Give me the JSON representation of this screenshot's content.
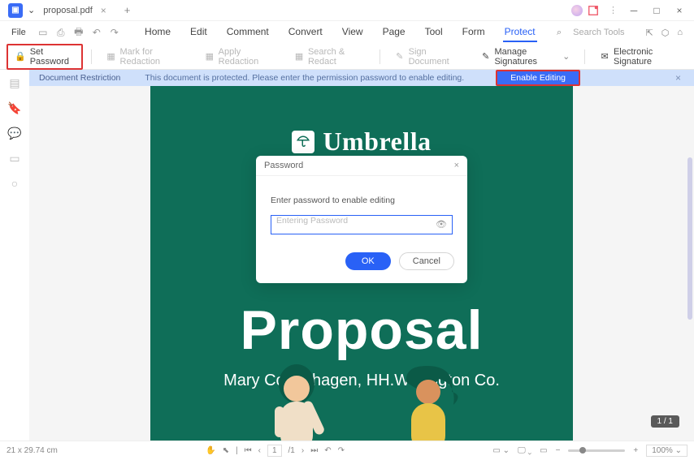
{
  "titlebar": {
    "filename": "proposal.pdf"
  },
  "file_menu": {
    "label": "File"
  },
  "menu_tabs": {
    "home": "Home",
    "edit": "Edit",
    "comment": "Comment",
    "convert": "Convert",
    "view": "View",
    "page": "Page",
    "tool": "Tool",
    "form": "Form",
    "protect": "Protect"
  },
  "menu_right": {
    "search": "Search Tools"
  },
  "ribbon": {
    "set_password": "Set Password",
    "mark_redaction": "Mark for Redaction",
    "apply_redaction": "Apply Redaction",
    "search_redact": "Search & Redact",
    "sign_document": "Sign Document",
    "manage_sigs": "Manage Signatures",
    "esign": "Electronic Signature"
  },
  "restriction_bar": {
    "title": "Document Restriction",
    "message": "This document is protected. Please enter the permission password to enable editing.",
    "enable_btn": "Enable Editing"
  },
  "document": {
    "brand": "Umbrella",
    "title": "Proposal",
    "subtitle": "Mary Copenhagen, HH.Wellington Co."
  },
  "password_dialog": {
    "title": "Password",
    "message": "Enter password to enable editing",
    "placeholder": "Entering Password",
    "ok": "OK",
    "cancel": "Cancel"
  },
  "page_indicator": "1 / 1",
  "status": {
    "dimensions": "21 x 29.74 cm",
    "page_input": "1",
    "page_total": "/1",
    "zoom": "100%"
  }
}
